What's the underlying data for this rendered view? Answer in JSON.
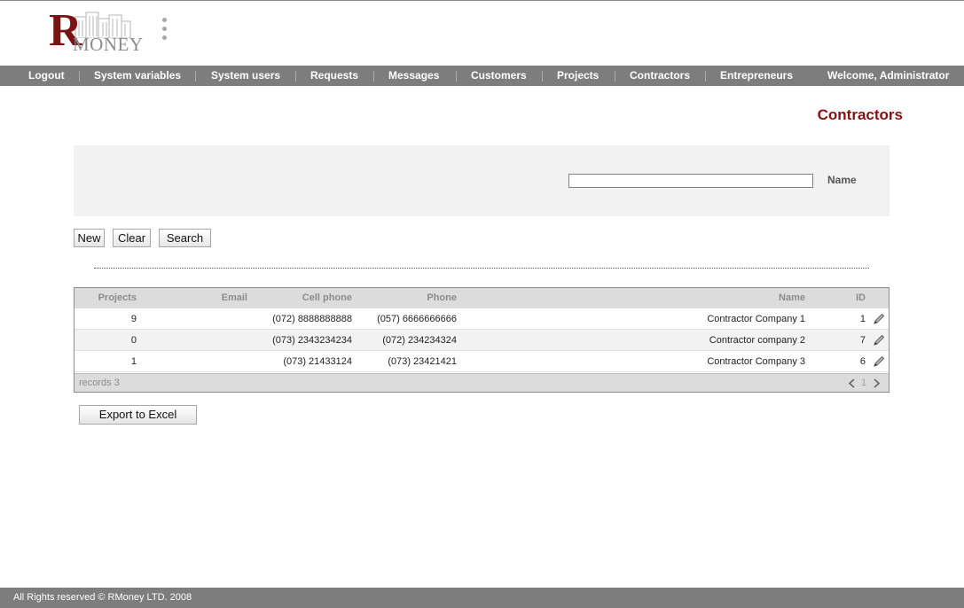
{
  "brand": {
    "letter": "R",
    "word": "MONEY"
  },
  "nav": {
    "items": [
      {
        "label": "Logout"
      },
      {
        "label": "System variables"
      },
      {
        "label": "System users"
      },
      {
        "label": "Requests"
      },
      {
        "label": "Messages"
      },
      {
        "label": "Customers"
      },
      {
        "label": "Projects"
      },
      {
        "label": "Contractors"
      },
      {
        "label": "Entrepreneurs"
      }
    ],
    "welcome": "Welcome, Administrator"
  },
  "page": {
    "title": "Contractors"
  },
  "search": {
    "name_label": "Name",
    "name_value": ""
  },
  "actions": {
    "new_label": "New",
    "clear_label": "Clear",
    "search_label": "Search",
    "export_label": "Export to Excel"
  },
  "grid": {
    "columns": {
      "projects": "Projects",
      "email": "Email",
      "cell_phone": "Cell phone",
      "phone": "Phone",
      "name": "Name",
      "id": "ID"
    },
    "rows": [
      {
        "projects": "9",
        "email": "",
        "cell_phone": "(072) 8888888888",
        "phone": "(057) 6666666666",
        "name": "Contractor Company 1",
        "id": "1"
      },
      {
        "projects": "0",
        "email": "",
        "cell_phone": "(073) 2343234234",
        "phone": "(072) 234234324",
        "name": "Contractor company 2",
        "id": "7"
      },
      {
        "projects": "1",
        "email": "",
        "cell_phone": "(073) 21433124",
        "phone": "(073) 23421421",
        "name": "Contractor Company 3",
        "id": "6"
      }
    ],
    "records_label": "records 3",
    "page_number": "1"
  },
  "icons": {
    "edit": "pencil-icon",
    "prev": "chevron-left-icon",
    "next": "chevron-right-icon"
  },
  "colors": {
    "accent": "#8b0f0f",
    "nav_bg": "#7d7d7d",
    "panel_bg": "#f3f2f2",
    "grid_header": "#dcdcdc"
  },
  "footer": {
    "copyright": "All Rights reserved © RMoney LTD. 2008"
  }
}
